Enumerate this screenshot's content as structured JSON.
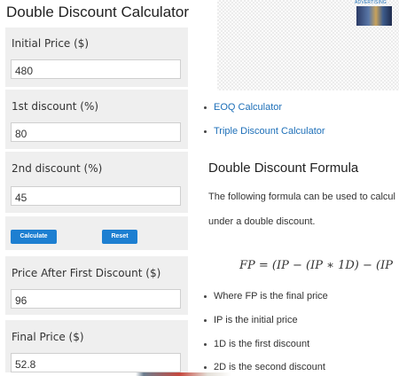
{
  "calculator": {
    "title": "Double Discount Calculator",
    "fields": [
      {
        "label": "Initial Price ($)",
        "value": "480"
      },
      {
        "label": "1st discount (%)",
        "value": "80"
      },
      {
        "label": "2nd discount (%)",
        "value": "45"
      },
      {
        "label": "Price After First Discount ($)",
        "value": "96"
      },
      {
        "label": "Final Price ($)",
        "value": "52.8"
      }
    ],
    "calculate_label": "Calculate",
    "reset_label": "Reset",
    "accent_color": "#1d7fd1"
  },
  "advertisement": {
    "label": "ADVERTISING"
  },
  "related_links": [
    {
      "label": "EOQ Calculator"
    },
    {
      "label": "Triple Discount Calculator"
    }
  ],
  "article": {
    "heading": "Double Discount Formula",
    "intro_line1": "The following formula can be used to calcul",
    "intro_line2": "under a double discount.",
    "formula": "FP = (IP − (IP ∗ 1D) − (IP",
    "bullets": [
      "Where FP is the final price",
      "IP is the initial price",
      "1D is the first discount",
      "2D is the second discount"
    ]
  },
  "colors": {
    "panel_bg": "#efefef",
    "link": "#1d6fb8"
  }
}
